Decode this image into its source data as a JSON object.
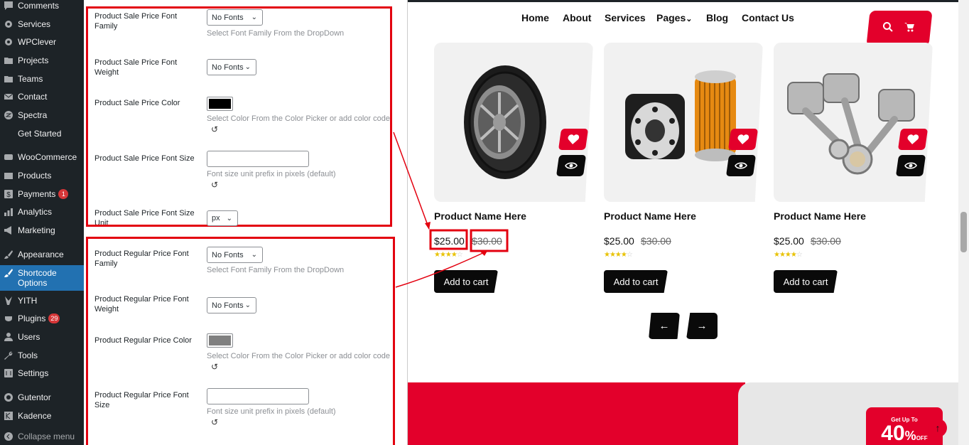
{
  "sidebar": {
    "items": [
      {
        "label": "Comments",
        "icon": "comment-icon"
      },
      {
        "label": "Services",
        "icon": "gear-icon"
      },
      {
        "label": "WPClever",
        "icon": "gear-icon"
      },
      {
        "label": "Projects",
        "icon": "folder-icon"
      },
      {
        "label": "Teams",
        "icon": "folder-icon"
      },
      {
        "label": "Contact",
        "icon": "mail-icon"
      },
      {
        "label": "Spectra",
        "icon": "spectra-icon"
      },
      {
        "label": "Get Started",
        "icon": ""
      },
      {
        "label": "WooCommerce",
        "icon": "woocommerce-icon"
      },
      {
        "label": "Products",
        "icon": "box-icon"
      },
      {
        "label": "Payments",
        "icon": "dollar-icon",
        "badge": "1"
      },
      {
        "label": "Analytics",
        "icon": "bar-chart-icon"
      },
      {
        "label": "Marketing",
        "icon": "megaphone-icon"
      },
      {
        "label": "Appearance",
        "icon": "brush-icon"
      },
      {
        "label": "Shortcode Options",
        "icon": "brush-icon"
      },
      {
        "label": "YITH",
        "icon": "yith-icon"
      },
      {
        "label": "Plugins",
        "icon": "plug-icon",
        "badge": "29"
      },
      {
        "label": "Users",
        "icon": "user-icon"
      },
      {
        "label": "Tools",
        "icon": "wrench-icon"
      },
      {
        "label": "Settings",
        "icon": "settings-icon"
      },
      {
        "label": "Gutentor",
        "icon": "gutentor-icon"
      },
      {
        "label": "Kadence",
        "icon": "kadence-icon"
      },
      {
        "label": "Collapse menu",
        "icon": "collapse-icon"
      }
    ]
  },
  "settings": {
    "sale_font_family_label": "Product Sale Price Font Family",
    "sale_font_family_value": "No Fonts",
    "sale_font_family_help": "Select Font Family From the DropDown",
    "sale_font_weight_label": "Product Sale Price Font Weight",
    "sale_font_weight_value": "No Fonts",
    "sale_color_label": "Product Sale Price Color",
    "sale_color_value": "#000000",
    "sale_color_help": "Select Color From the Color Picker or add color code",
    "sale_font_size_label": "Product Sale Price Font Size",
    "sale_font_size_help": "Font size unit prefix in pixels (default)",
    "sale_font_size_unit_label": "Product Sale Price Font Size Unit",
    "sale_font_size_unit_value": "px",
    "regular_font_family_label": "Product Regular Price Font Family",
    "regular_font_family_value": "No Fonts",
    "regular_font_family_help": "Select Font Family From the DropDown",
    "regular_font_weight_label": "Product Regular Price Font Weight",
    "regular_font_weight_value": "No Fonts",
    "regular_color_label": "Product Regular Price Color",
    "regular_color_value": "#808080",
    "regular_color_help": "Select Color From the Color Picker or add color code",
    "regular_font_size_label": "Product Regular Price Font Size",
    "regular_font_size_help": "Font size unit prefix in pixels (default)",
    "reset_glyph": "↺"
  },
  "preview": {
    "nav": [
      "Home",
      "About",
      "Services",
      "Pages",
      "Blog",
      "Contact Us"
    ],
    "pages_chevron": "⌄",
    "products": [
      {
        "name": "Product Name Here",
        "price": "$25.00",
        "old_price": "$30.00",
        "rating": 4,
        "image": "tire"
      },
      {
        "name": "Product Name Here",
        "price": "$25.00",
        "old_price": "$30.00",
        "rating": 4,
        "image": "oil-filter"
      },
      {
        "name": "Product Name Here",
        "price": "$25.00",
        "old_price": "$30.00",
        "rating": 4,
        "image": "pistons"
      }
    ],
    "add_to_cart": "Add to cart",
    "prev_glyph": "←",
    "next_glyph": "→",
    "promo_small": "Get Up To",
    "promo_big": "40",
    "promo_percent": "%",
    "promo_off": "OFF",
    "scroll_top_glyph": "↑"
  },
  "colors": {
    "sidebar_bg": "#1d2327",
    "sidebar_active": "#2271b1",
    "accent_red": "#e3002b",
    "annotation_red": "#e3000f"
  }
}
